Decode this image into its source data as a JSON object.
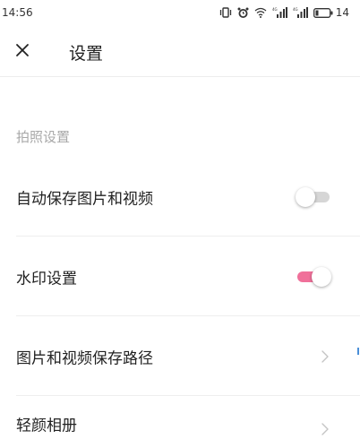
{
  "status_bar": {
    "time": "14:56",
    "battery": "14",
    "icons": [
      "vibrate-icon",
      "alarm-icon",
      "wifi-icon",
      "signal-icon",
      "signal-icon",
      "battery-icon"
    ]
  },
  "header": {
    "close_icon": "close-icon",
    "title": "设置"
  },
  "section": {
    "label": "拍照设置"
  },
  "rows": [
    {
      "label": "自动保存图片和视频",
      "control": "toggle",
      "state": "off"
    },
    {
      "label": "水印设置",
      "control": "toggle",
      "state": "on"
    },
    {
      "label": "图片和视频保存路径",
      "control": "chevron-right-icon"
    },
    {
      "label": "轻颜相册",
      "control": "chevron-right-icon"
    }
  ],
  "colors": {
    "toggle_on": "#f0709a",
    "toggle_off": "#d6d6d6",
    "section_label": "#a8a8a8"
  }
}
